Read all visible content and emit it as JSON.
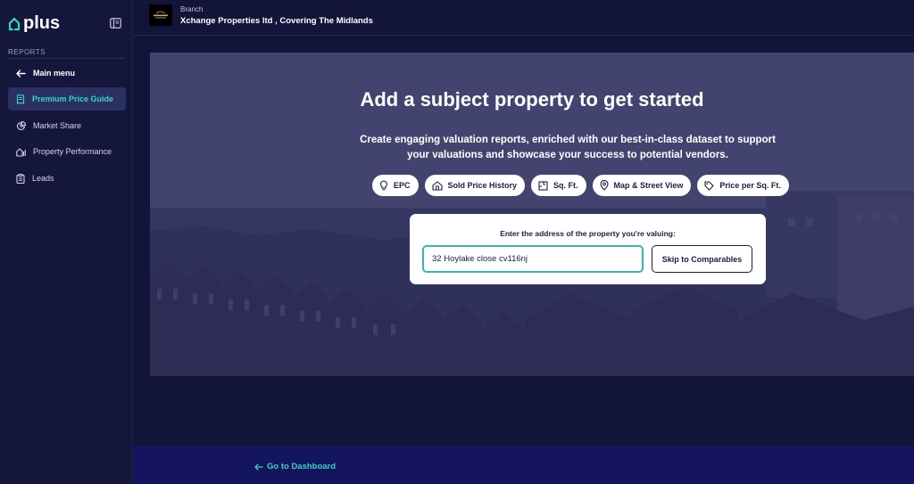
{
  "brand": {
    "name": "plus",
    "accent": "#35d4be"
  },
  "sidebar": {
    "section_label": "REPORTS",
    "main_menu_label": "Main menu",
    "items": [
      {
        "label": "Premium Price Guide",
        "icon": "receipt-icon",
        "active": true
      },
      {
        "label": "Market Share",
        "icon": "pie-chart-icon",
        "active": false
      },
      {
        "label": "Property Performance",
        "icon": "house-chart-icon",
        "active": false
      },
      {
        "label": "Leads",
        "icon": "clipboard-icon",
        "active": false
      }
    ]
  },
  "header": {
    "branch_label": "Branch",
    "branch_name": "Xchange Properties ltd , Covering The Midlands"
  },
  "hero": {
    "title": "Add a subject property to get started",
    "subtitle_line1": "Create engaging valuation reports, enriched with our best-in-class dataset to support",
    "subtitle_line2": "your valuations and showcase your success to potential vendors.",
    "features": [
      {
        "label": "EPC",
        "icon": "lightbulb-icon"
      },
      {
        "label": "Sold Price History",
        "icon": "house-icon"
      },
      {
        "label": "Sq. Ft.",
        "icon": "floorplan-icon"
      },
      {
        "label": "Map & Street View",
        "icon": "map-pin-icon"
      },
      {
        "label": "Price per Sq. Ft.",
        "icon": "price-tag-icon"
      }
    ]
  },
  "address": {
    "prompt": "Enter the address of the property you're valuing:",
    "value": "32 Hoylake close cv116nj",
    "skip_label": "Skip to Comparables"
  },
  "footer": {
    "dashboard_link": "Go to Dashboard"
  }
}
